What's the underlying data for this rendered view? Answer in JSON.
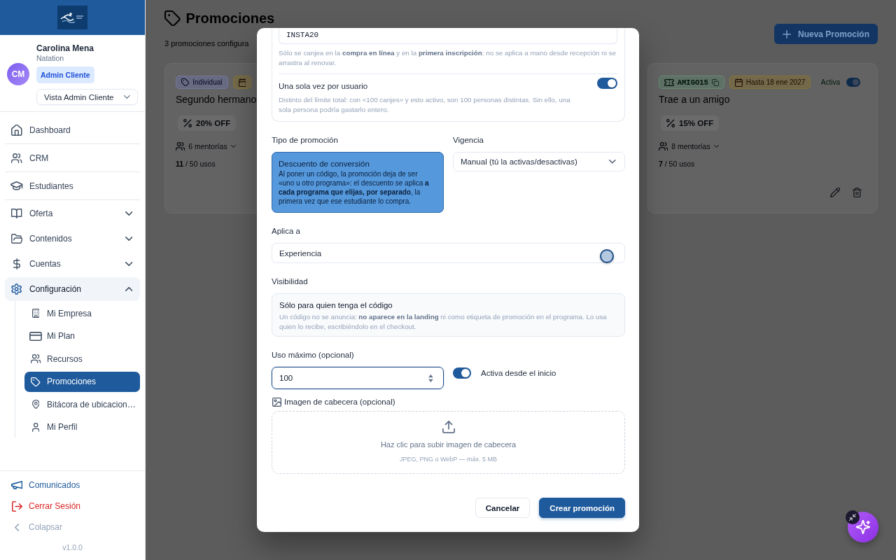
{
  "sidebar": {
    "user": {
      "initials": "CM",
      "name": "Carolina Mena",
      "organization": "Natation",
      "role": "Admin Cliente",
      "view": "Vista Admin Cliente"
    },
    "nav": [
      {
        "label": "Dashboard",
        "kind": "link",
        "selected": false
      },
      {
        "label": "CRM",
        "kind": "link",
        "selected": false
      },
      {
        "label": "Estudiantes",
        "kind": "link",
        "selected": false
      },
      {
        "label": "Oferta",
        "kind": "group",
        "selected": false,
        "expanded": false
      },
      {
        "label": "Contenidos",
        "kind": "group",
        "selected": false,
        "expanded": false
      },
      {
        "label": "Cuentas",
        "kind": "group",
        "selected": false,
        "expanded": false
      },
      {
        "label": "Configuración",
        "kind": "group",
        "selected": false,
        "expanded": true,
        "children": [
          {
            "label": "Mi Empresa",
            "selected": false
          },
          {
            "label": "Mi Plan",
            "selected": false
          },
          {
            "label": "Recursos",
            "selected": false
          },
          {
            "label": "Promociones",
            "selected": true
          },
          {
            "label": "Bitácora de ubicacion…",
            "selected": false
          },
          {
            "label": "Mi Perfil",
            "selected": false
          }
        ]
      }
    ],
    "footer": [
      {
        "label": "Comunicados",
        "kind": "primary"
      },
      {
        "label": "Cerrar Sesión",
        "kind": "danger"
      },
      {
        "label": "Colapsar",
        "kind": "muted"
      }
    ],
    "version": "v1.0.0"
  },
  "page": {
    "title": "Promociones",
    "subtitle": "3 promociones configura",
    "new_button": "Nueva Promoción",
    "cards": [
      {
        "badges": [
          {
            "kind": "type",
            "text": "Individual"
          },
          {
            "kind": "date"
          }
        ],
        "title": "Segundo hermano",
        "discount": "20% OFF",
        "scope": "6 mentorías",
        "usage": "**11** / 50 usos"
      },
      {
        "badges": [
          {
            "kind": "code",
            "text": "AMIGO15"
          },
          {
            "kind": "date",
            "text": "Hasta 18 ene 2027"
          }
        ],
        "status": "Activa",
        "active": true,
        "title": "Trae a un amigo",
        "discount": "15% OFF",
        "scope": "8 mentorías",
        "usage": "**7** / 50 usos"
      }
    ]
  },
  "modal": {
    "code": {
      "value": "INSTA20",
      "hint": "Sólo se canjea en la **compra en línea** y en la **primera inscripción**: no se aplica a mano desde recepción ni se arrastra al renovar.",
      "once_per_user": {
        "label": "Una sola vez por usuario",
        "on": true,
        "hint": "Distinto del límite total: con «100 canjes» y esto activo, son 100 personas distintas. Sin ello, una sola persona podría gastarlo entero."
      }
    },
    "promotion_type": {
      "label": "Tipo de promoción",
      "options": [
        {
          "title": "Descuento de conversión",
          "description": "Al poner un código, la promoción deja de ser «uno u otro programa»: el descuento se aplica **a cada programa que elijas, por separado**, la primera vez que ese estudiante lo compra.",
          "selected": true
        }
      ]
    },
    "validity": {
      "label": "Vigencia",
      "value": "Manual (tú la activas/desactivas)"
    },
    "applies_to": {
      "label": "Aplica a",
      "value": "Experiencia"
    },
    "visibility": {
      "label": "Visibilidad",
      "title": "Sólo para quien tenga el código",
      "description": "Un código no se anuncia: **no aparece en la landing** ni como etiqueta de promoción en el programa. Lo usa quien lo recibe, escribiéndolo en el checkout."
    },
    "max_uses": {
      "label": "Uso máximo (opcional)",
      "value": "100"
    },
    "active_from_start": {
      "label": "Activa desde el inicio",
      "on": true
    },
    "header_image": {
      "label": "Imagen de cabecera (opcional)",
      "upload_text": "Haz clic para subir imagen de cabecera",
      "formats": "JPEG, PNG o WebP — máx. 5 MB"
    },
    "buttons": [
      {
        "label": "Cancelar",
        "kind": "secondary"
      },
      {
        "label": "Crear promoción",
        "kind": "primary"
      }
    ]
  }
}
